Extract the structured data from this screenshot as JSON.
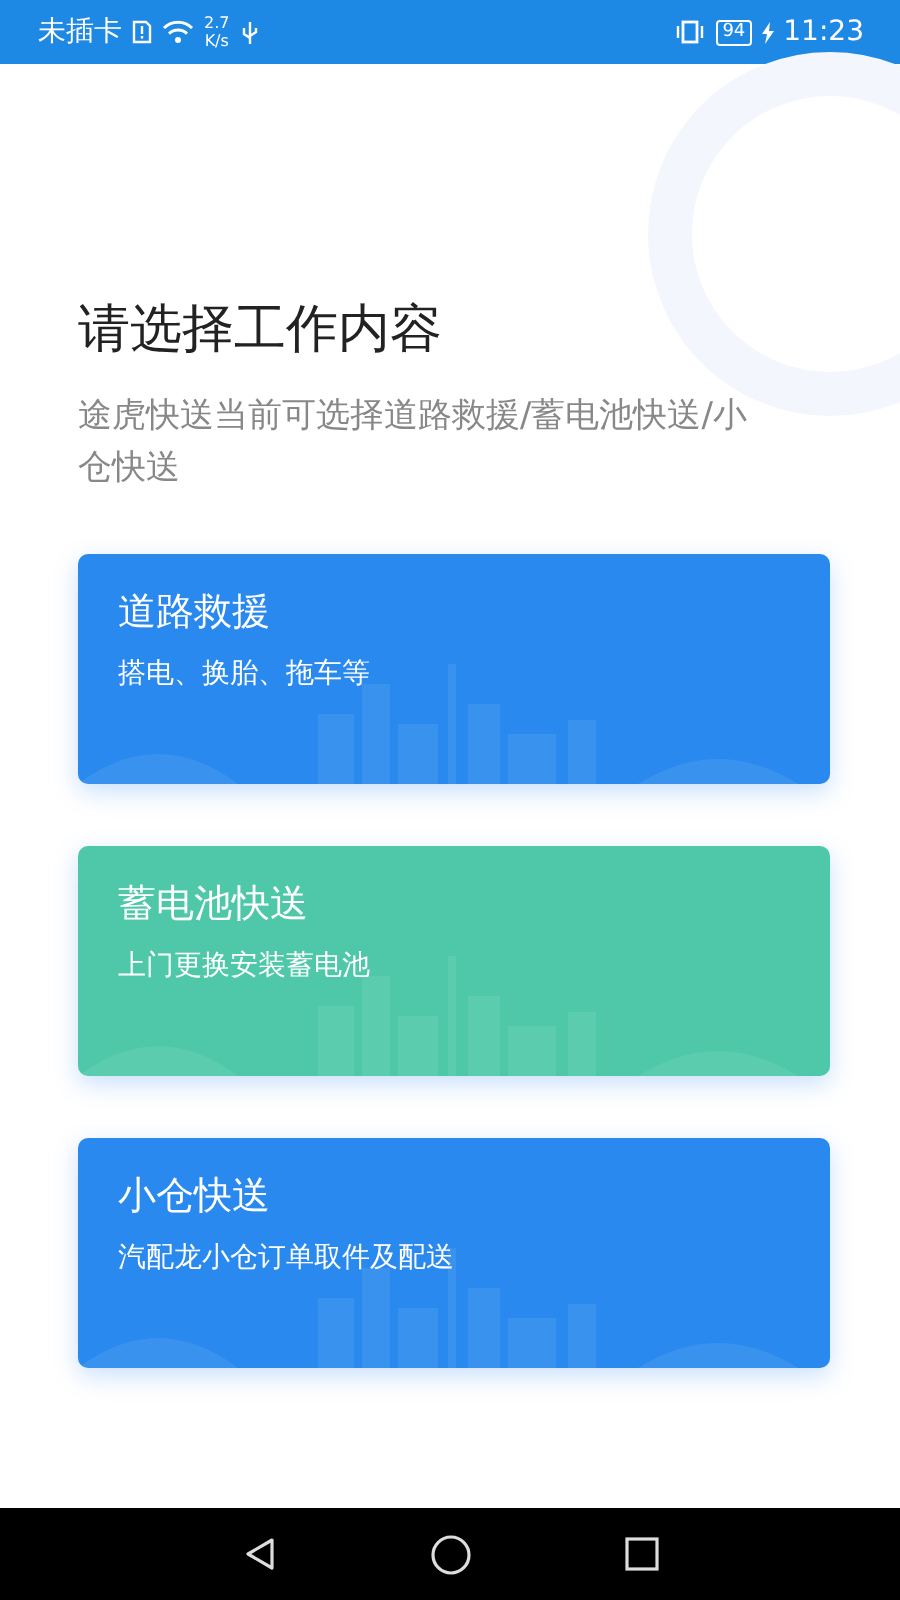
{
  "status_bar": {
    "carrier": "未插卡",
    "net_speed_value": "2.7",
    "net_speed_unit": "K/s",
    "battery": "94",
    "time": "11:23"
  },
  "title": "请选择工作内容",
  "subtitle": "途虎快送当前可选择道路救援/蓄电池快送/小仓快送",
  "options": [
    {
      "title": "道路救援",
      "description": "搭电、换胎、拖车等",
      "color": "#2a89ee"
    },
    {
      "title": "蓄电池快送",
      "description": "上门更换安装蓄电池",
      "color": "#4ec8a8"
    },
    {
      "title": "小仓快送",
      "description": "汽配龙小仓订单取件及配送",
      "color": "#2a89ee"
    }
  ]
}
